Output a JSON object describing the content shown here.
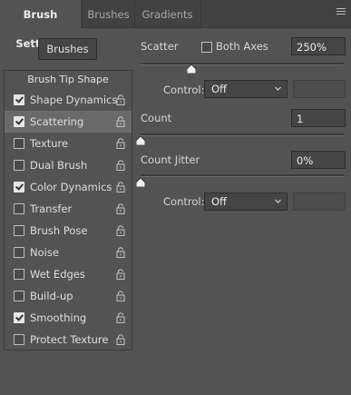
{
  "tabs": [
    {
      "label": "Brush Settings",
      "active": true
    },
    {
      "label": "Brushes",
      "active": false
    },
    {
      "label": "Gradients",
      "active": false
    }
  ],
  "brushes_button": "Brushes",
  "options": {
    "header": "Brush Tip Shape",
    "items": [
      {
        "label": "Shape Dynamics",
        "checked": true,
        "selected": false
      },
      {
        "label": "Scattering",
        "checked": true,
        "selected": true
      },
      {
        "label": "Texture",
        "checked": false,
        "selected": false
      },
      {
        "label": "Dual Brush",
        "checked": false,
        "selected": false
      },
      {
        "label": "Color Dynamics",
        "checked": true,
        "selected": false
      },
      {
        "label": "Transfer",
        "checked": false,
        "selected": false
      },
      {
        "label": "Brush Pose",
        "checked": false,
        "selected": false
      },
      {
        "label": "Noise",
        "checked": false,
        "selected": false
      },
      {
        "label": "Wet Edges",
        "checked": false,
        "selected": false
      },
      {
        "label": "Build-up",
        "checked": false,
        "selected": false
      },
      {
        "label": "Smoothing",
        "checked": true,
        "selected": false
      },
      {
        "label": "Protect Texture",
        "checked": false,
        "selected": false
      }
    ]
  },
  "scatter": {
    "label": "Scatter",
    "both_axes_label": "Both Axes",
    "both_axes_checked": false,
    "value": "250%",
    "control_label": "Control:",
    "control_value": "Off"
  },
  "count": {
    "label": "Count",
    "value": "1"
  },
  "count_jitter": {
    "label": "Count Jitter",
    "value": "0%",
    "control_label": "Control:",
    "control_value": "Off"
  },
  "colors": {
    "panel_bg": "#535353",
    "selected_row": "#6a6a6a",
    "field_bg": "#454545"
  }
}
